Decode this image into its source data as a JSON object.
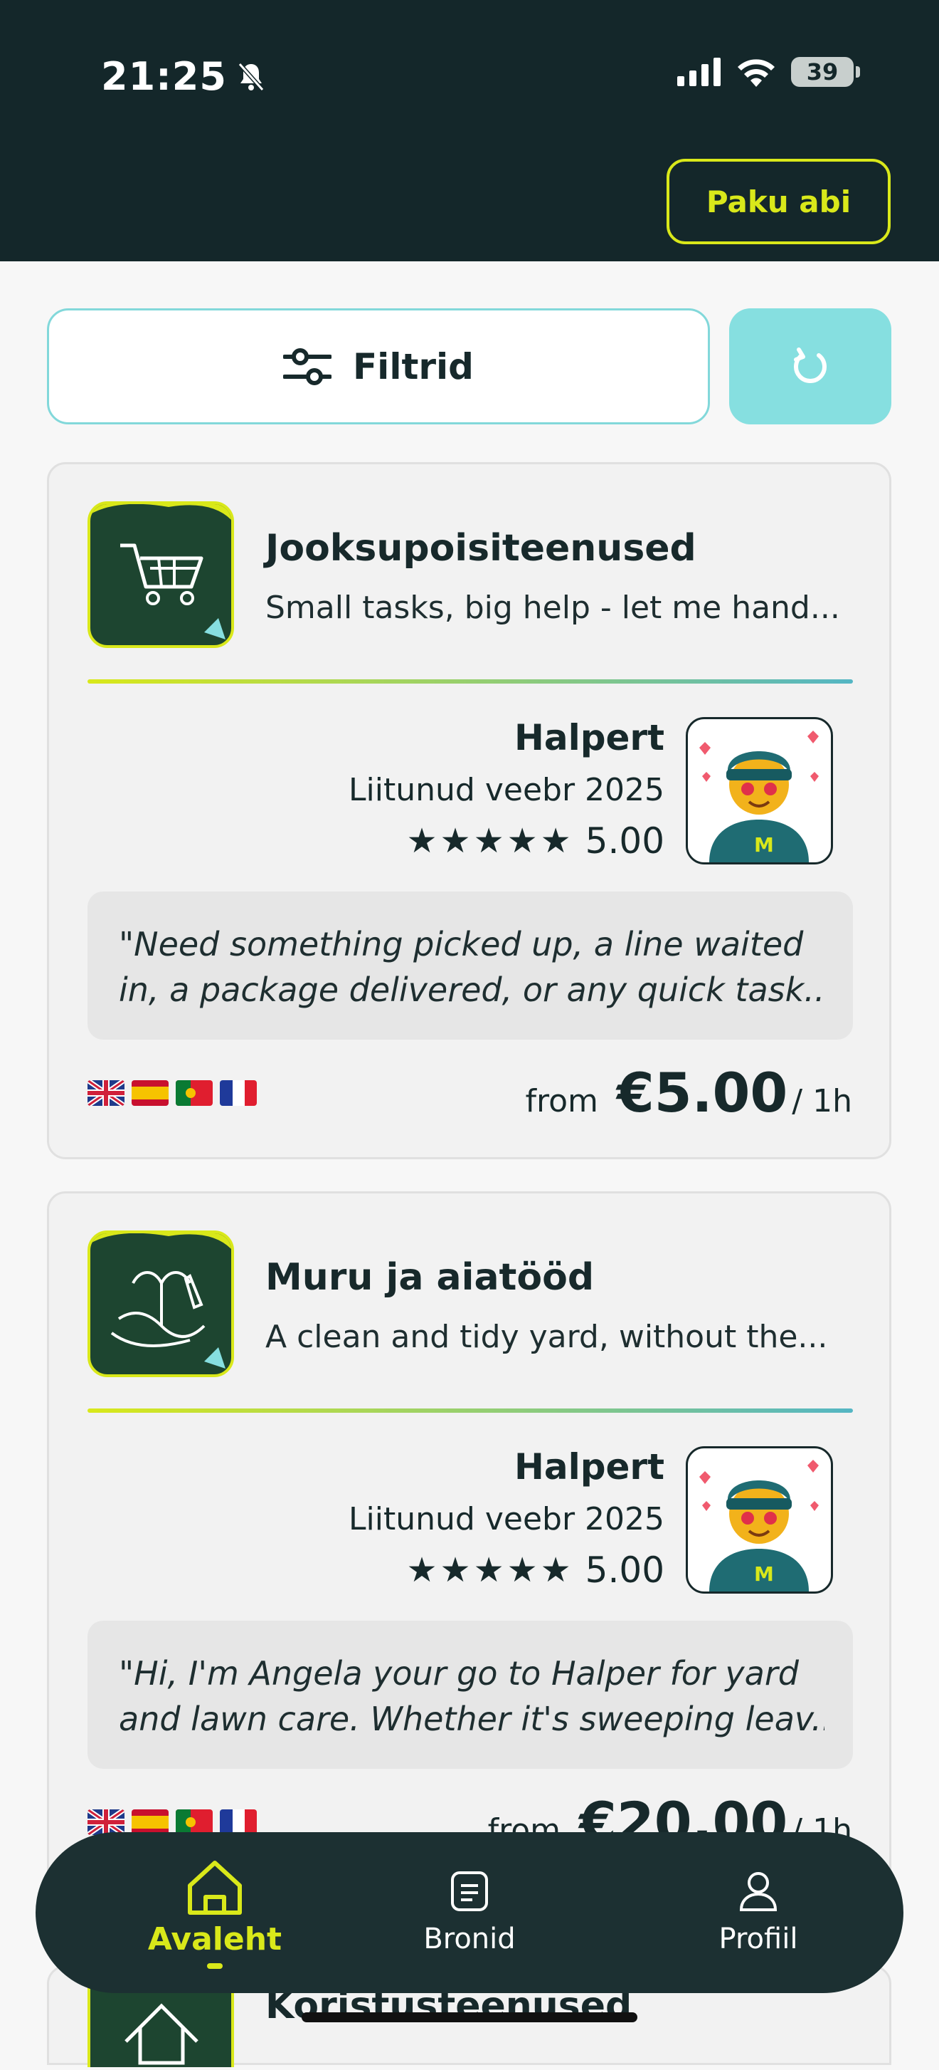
{
  "status_bar": {
    "time": "21:25",
    "battery": "39",
    "icons": [
      "bell-slash-icon",
      "signal-icon",
      "wifi-icon",
      "battery-icon"
    ]
  },
  "header": {
    "offer_help_label": "Paku abi"
  },
  "toolbar": {
    "filter_label": "Filtrid",
    "filter_icon": "sliders-icon",
    "refresh_icon": "refresh-icon"
  },
  "listings": [
    {
      "category_title": "Jooksupoisiteenused",
      "category_subtitle": "Small tasks, big help - let me hand...",
      "category_icon": "shopping-cart-icon",
      "provider_name": "Halpert",
      "provider_joined": "Liitunud veebr 2025",
      "rating": "5.00",
      "stars": "★★★★★",
      "quote_line1": "\"Need something picked up, a line waited",
      "quote_line2": "in, a package delivered, or any quick task...",
      "languages": [
        "gb-flag-icon",
        "es-flag-icon",
        "pt-flag-icon",
        "fr-flag-icon"
      ],
      "price_from": "from",
      "price_amount": "€5.00",
      "price_unit": "/ 1h"
    },
    {
      "category_title": "Muru ja aiatööd",
      "category_subtitle": "A clean and tidy yard, without the...",
      "category_icon": "gardening-icon",
      "provider_name": "Halpert",
      "provider_joined": "Liitunud veebr 2025",
      "rating": "5.00",
      "stars": "★★★★★",
      "quote_line1": "\"Hi, I'm Angela your go to Halper for yard",
      "quote_line2": "and lawn care. Whether it's sweeping leav...",
      "languages": [
        "gb-flag-icon",
        "es-flag-icon",
        "pt-flag-icon",
        "fr-flag-icon"
      ],
      "price_from": "from",
      "price_amount": "€20.00",
      "price_unit": "/ 1h"
    },
    {
      "category_title": "Koristusteenused"
    }
  ],
  "bottom_nav": [
    {
      "label": "Avaleht",
      "icon": "home-icon",
      "active": true
    },
    {
      "label": "Bronid",
      "icon": "document-icon",
      "active": false
    },
    {
      "label": "Profiil",
      "icon": "person-icon",
      "active": false
    }
  ],
  "colors": {
    "header_bg": "#14272a",
    "accent_yellow": "#d9e81a",
    "accent_cyan": "#86dfe0",
    "card_bg": "#f2f2f2"
  }
}
